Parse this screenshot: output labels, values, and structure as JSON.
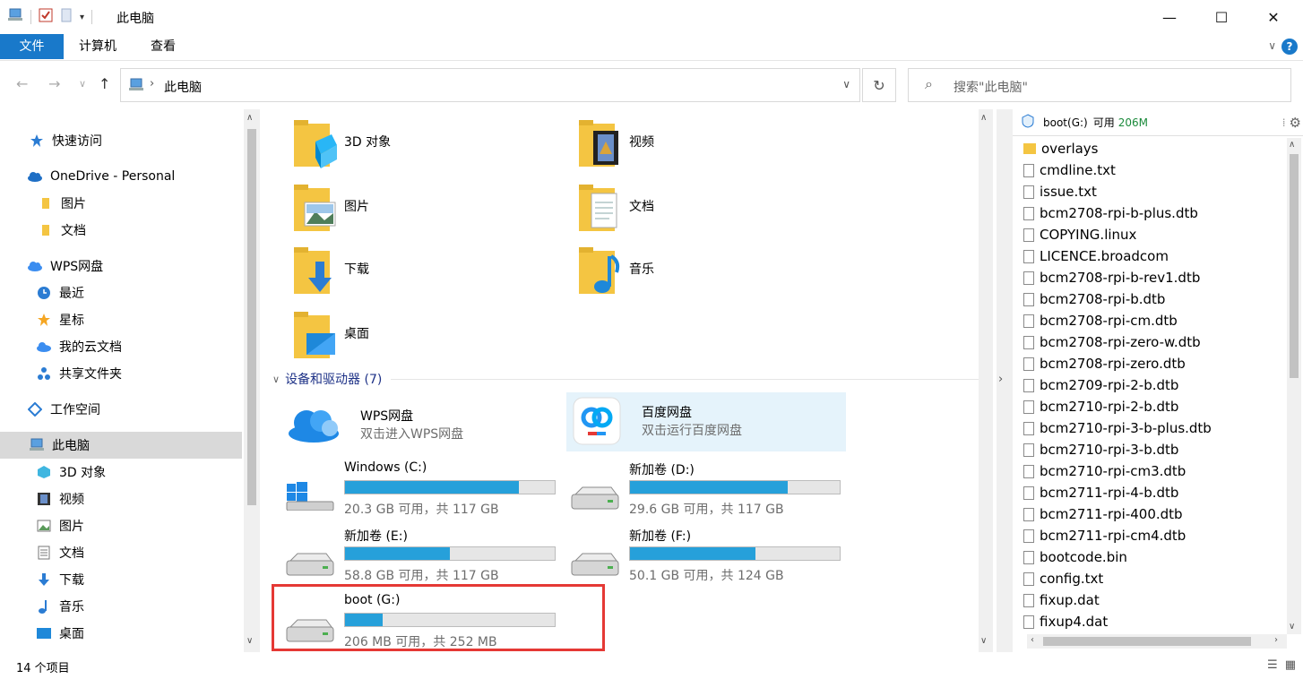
{
  "window": {
    "title": "此电脑",
    "minimize": "—",
    "maximize": "☐",
    "close": "✕"
  },
  "ribbon": {
    "tabs": [
      "文件",
      "计算机",
      "查看"
    ]
  },
  "address": {
    "crumb": "此电脑",
    "search_placeholder": "搜索\"此电脑\""
  },
  "nav": {
    "quick_access": "快速访问",
    "onedrive": "OneDrive - Personal",
    "onedrive_children": [
      "图片",
      "文档"
    ],
    "wps": "WPS网盘",
    "wps_children": [
      "最近",
      "星标",
      "我的云文档",
      "共享文件夹"
    ],
    "workspace": "工作空间",
    "this_pc": "此电脑",
    "pc_children": [
      "3D 对象",
      "视频",
      "图片",
      "文档",
      "下载",
      "音乐",
      "桌面"
    ]
  },
  "folders": [
    "3D 对象",
    "视频",
    "图片",
    "文档",
    "下载",
    "音乐",
    "桌面"
  ],
  "devices_header": "设备和驱动器 (7)",
  "apps": [
    {
      "name": "WPS网盘",
      "sub": "双击进入WPS网盘"
    },
    {
      "name": "百度网盘",
      "sub": "双击运行百度网盘"
    }
  ],
  "drives": [
    {
      "name": "Windows  (C:)",
      "sub": "20.3 GB 可用，共 117 GB",
      "used_fraction": 0.83
    },
    {
      "name": "新加卷 (D:)",
      "sub": "29.6 GB 可用，共 117 GB",
      "used_fraction": 0.75
    },
    {
      "name": "新加卷 (E:)",
      "sub": "58.8 GB 可用，共 117 GB",
      "used_fraction": 0.5
    },
    {
      "name": "新加卷 (F:)",
      "sub": "50.1 GB 可用，共 124 GB",
      "used_fraction": 0.6
    },
    {
      "name": "boot (G:)",
      "sub": "206 MB 可用，共 252 MB",
      "used_fraction": 0.18
    }
  ],
  "preview": {
    "drive_label": "boot(G:)",
    "free_prefix": "可用",
    "free_value": "206M",
    "files": [
      "overlays",
      "cmdline.txt",
      "issue.txt",
      "bcm2708-rpi-b-plus.dtb",
      "COPYING.linux",
      "LICENCE.broadcom",
      "bcm2708-rpi-b-rev1.dtb",
      "bcm2708-rpi-b.dtb",
      "bcm2708-rpi-cm.dtb",
      "bcm2708-rpi-zero-w.dtb",
      "bcm2708-rpi-zero.dtb",
      "bcm2709-rpi-2-b.dtb",
      "bcm2710-rpi-2-b.dtb",
      "bcm2710-rpi-3-b-plus.dtb",
      "bcm2710-rpi-3-b.dtb",
      "bcm2710-rpi-cm3.dtb",
      "bcm2711-rpi-4-b.dtb",
      "bcm2711-rpi-400.dtb",
      "bcm2711-rpi-cm4.dtb",
      "bootcode.bin",
      "config.txt",
      "fixup.dat",
      "fixup4.dat"
    ]
  },
  "status": {
    "item_count": "14 个项目"
  },
  "colors": {
    "accent": "#1979ca",
    "drive_bar": "#26a0da",
    "highlight": "#e5f3fb",
    "red_box": "#e53935"
  }
}
